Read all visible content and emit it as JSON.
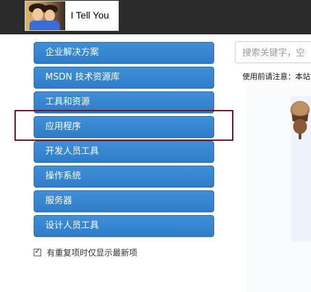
{
  "header": {
    "logo_text": "I Tell You"
  },
  "sidebar": {
    "items": [
      {
        "label": "企业解决方案"
      },
      {
        "label": "MSDN 技术资源库"
      },
      {
        "label": "工具和资源"
      },
      {
        "label": "应用程序"
      },
      {
        "label": "开发人员工具"
      },
      {
        "label": "操作系统"
      },
      {
        "label": "服务器"
      },
      {
        "label": "设计人员工具"
      }
    ],
    "checkbox_label": "有重复项时仅显示最新项"
  },
  "search": {
    "placeholder": "搜索关键字，空"
  },
  "notice": {
    "text": "使用前请注意：本站"
  },
  "colors": {
    "menu_blue": "#3582cf",
    "highlight_border": "#7a1128",
    "topbar": "#2b2b2b"
  },
  "icons": {
    "acorn": "acorn-icon",
    "checkbox_checked": "check-icon"
  }
}
